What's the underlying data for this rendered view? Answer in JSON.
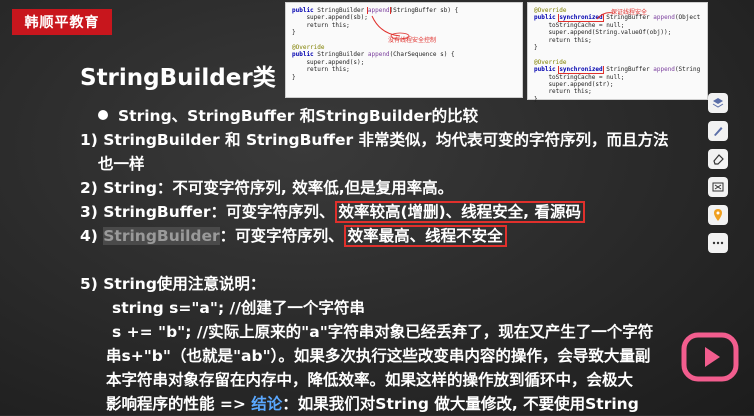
{
  "brand": "韩顺平教育",
  "title": "StringBuilder类",
  "code_panel_1": {
    "lines": [
      "public StringBuilder append(StringBuffer sb) {",
      "    super.append(sb);",
      "    return this;",
      "}",
      "",
      "@Override",
      "public StringBuilder append(CharSequence s) {",
      "    super.append(s);",
      "    return this;",
      "}"
    ],
    "note": "没有线程安全控制"
  },
  "code_panel_2": {
    "lines": [
      "@Override",
      "public synchronized StringBuffer append(Object obj) {",
      "    toStringCache = null;",
      "    super.append(String.valueOf(obj));",
      "    return this;",
      "}",
      "",
      "@Override",
      "public synchronized StringBuffer append(String str) {",
      "    toStringCache = null;",
      "    super.append(str);",
      "    return this;",
      "}"
    ],
    "note": "保证线程安全"
  },
  "content": {
    "heading": "String、StringBuffer 和StringBuilder的比较",
    "p1_line1": "1) StringBuilder 和 StringBuffer 非常类似，均代表可变的字符序列，而且方法",
    "p1_line2": "也一样",
    "p2": "2) String：不可变字符序列, 效率低,但是复用率高。",
    "p3_prefix": "3) StringBuffer：可变字符序列、",
    "p3_boxed": "效率较高(增删)、线程安全, 看源码",
    "p4_num": "4) ",
    "p4_name": "StringBuilder",
    "p4_mid": "：可变字符序列、",
    "p4_boxed": "效率最高、线程不安全",
    "p5_title": "5) String使用注意说明：",
    "p5_l1": "string s=\"a\"; //创建了一个字符串",
    "p5_l2": "s += \"b\"; //实际上原来的\"a\"字符串对象已经丢弃了，现在又产生了一个字符",
    "p5_l3": "串s+\"b\"（也就是\"ab\"）。如果多次执行这些改变串内容的操作，会导致大量副",
    "p5_l4": "本字符串对象存留在内存中，降低效率。如果这样的操作放到循环中，会极大",
    "p5_l5_pre": "影响程序的性能 => ",
    "p5_l5_key": "结论",
    "p5_l5_post": "：如果我们对String 做大量修改, 不要使用String"
  },
  "colors": {
    "brand_red": "#c8161d",
    "highlight_red": "#e0302c",
    "conclusion_blue": "#5aa8ff",
    "play_pink": "#f25d8e"
  },
  "tool_icons": [
    "layers-icon",
    "pen-icon",
    "eraser-icon",
    "clear-icon",
    "location-icon",
    "more-icon"
  ]
}
